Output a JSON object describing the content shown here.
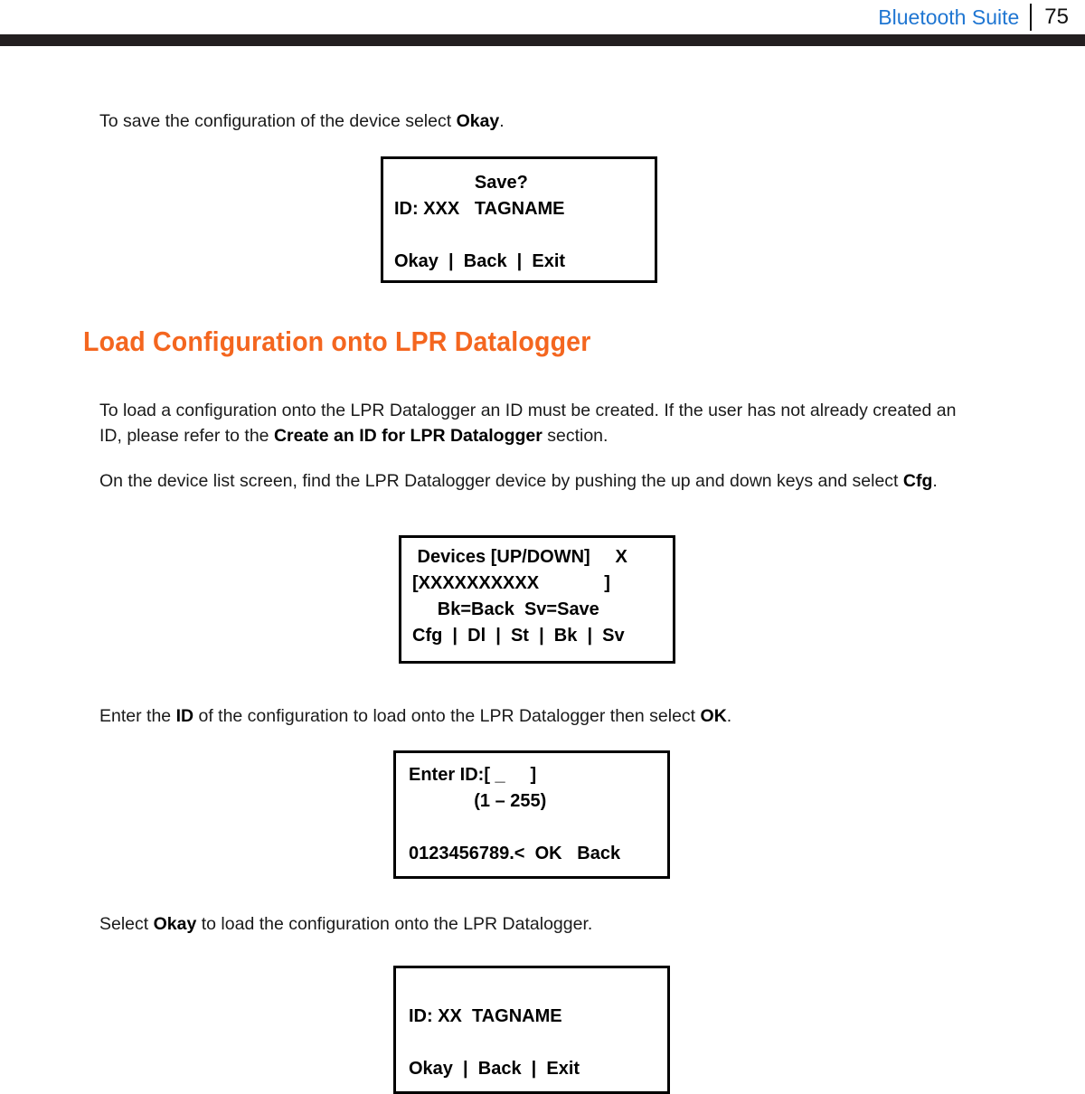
{
  "header": {
    "title": "Bluetooth Suite",
    "page_number": "75",
    "title_color": "#1f76d2",
    "rule_color": "#231f20"
  },
  "section": {
    "heading": "Load Configuration onto LPR Datalogger",
    "heading_color": "#f4661f"
  },
  "paragraphs": {
    "p1": {
      "pre": "To save the configuration of the device select ",
      "bold": "Okay",
      "post": "."
    },
    "p2": {
      "pre": "To load a configuration onto the LPR Datalogger an ID must be created. If the user has not already created an ID, please refer to the ",
      "bold": "Create an ID for LPR Datalogger",
      "post": " section."
    },
    "p3": {
      "pre": "On the device list screen, find the LPR Datalogger device by pushing the up and down keys and select ",
      "bold": "Cfg",
      "post": "."
    },
    "p4": {
      "pre": "Enter the ",
      "bold": "ID",
      "mid": " of the configuration to load onto the LPR Datalogger then select ",
      "bold2": "OK",
      "post": "."
    },
    "p5": {
      "pre": "Select ",
      "bold": "Okay",
      "post": " to load the configuration onto the LPR Datalogger."
    }
  },
  "lcd_screens": [
    {
      "id": "save-confirm",
      "lines": [
        "                Save?",
        "ID: XXX   TAGNAME",
        "",
        "Okay  |  Back  |  Exit"
      ]
    },
    {
      "id": "device-list",
      "lines": [
        " Devices [UP/DOWN]     X",
        "[XXXXXXXXXX             ]",
        "     Bk=Back  Sv=Save",
        "Cfg  |  Dl  |  St  |  Bk  |  Sv"
      ]
    },
    {
      "id": "enter-id",
      "lines": [
        "Enter ID:[ _     ]",
        "             (1 – 255)",
        "",
        "0123456789.<  OK   Back"
      ]
    },
    {
      "id": "load-confirm",
      "lines": [
        "",
        "ID: XX  TAGNAME",
        "",
        "Okay  |  Back  |  Exit"
      ]
    }
  ]
}
